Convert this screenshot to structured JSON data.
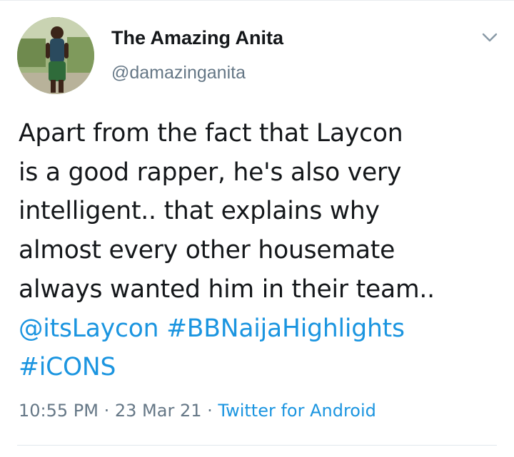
{
  "author": {
    "display_name": "The Amazing Anita",
    "handle": "@damazinganita"
  },
  "more_icon": "chevron-down-icon",
  "tweet": {
    "lines": [
      "Apart from the fact that Laycon",
      "is a good rapper, he's also very",
      "intelligent.. that explains why",
      "almost every other housemate",
      "always wanted him in their team.."
    ],
    "mention": "@itsLaycon",
    "hashtags": [
      "#BBNaijaHighlights",
      "#iCONS"
    ]
  },
  "meta": {
    "time": "10:55 PM",
    "separator": " · ",
    "date": "23 Mar 21",
    "source": "Twitter for Android"
  },
  "colors": {
    "text": "#14171a",
    "secondary": "#657786",
    "link": "#1b95e0"
  }
}
